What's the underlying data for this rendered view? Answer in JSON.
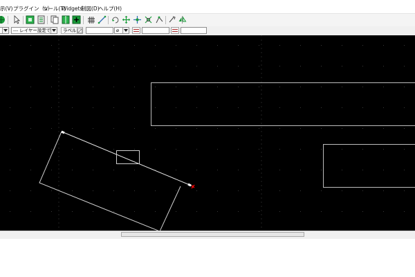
{
  "menu": {
    "items": [
      {
        "label": "示(V)"
      },
      {
        "label": "プラグイン（u）"
      },
      {
        "label": "ツール(T)"
      },
      {
        "label": "Widgets"
      },
      {
        "label": "制図(D)"
      },
      {
        "label": "ヘルプ(H)"
      }
    ]
  },
  "toolbar": {
    "layer_selector_value": "--- レイヤー設定で",
    "label_text": "ラベル",
    "angle_symbol": "ø"
  },
  "colors": {
    "canvas_background": "#000000",
    "drawing_lines": "#ffffff",
    "grid_dots": "#3a3a3a",
    "marker_red": "#ff0000",
    "green_icon": "#1a9c3a"
  },
  "icons": [
    "green-globe-icon",
    "pointer-icon",
    "green-layer-icon",
    "copy-page-icon",
    "split-view-icon",
    "green-plus-icon",
    "grid-icon",
    "line-tool-icon",
    "rotate-icon",
    "move-icon",
    "add-node-icon",
    "scale-icon",
    "edit-node-icon",
    "snap-icon",
    "mirror-icon"
  ]
}
